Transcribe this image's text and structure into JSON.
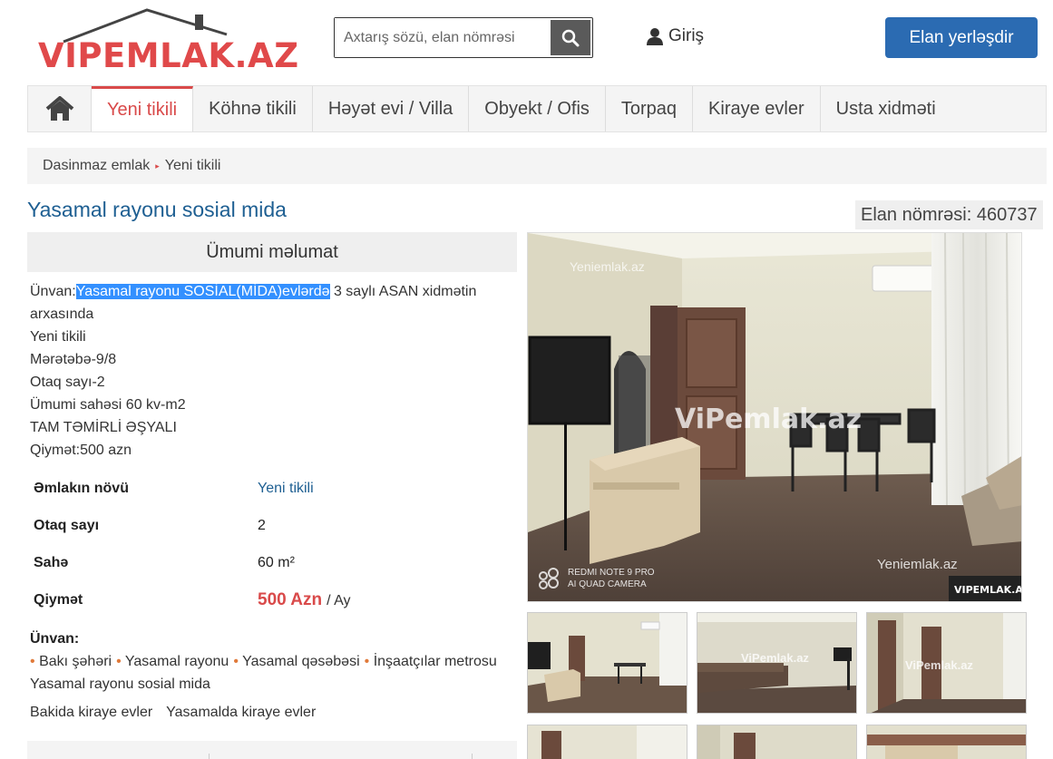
{
  "header": {
    "logo_text": "VIPEMLAK.AZ",
    "search_placeholder": "Axtarış sözü, elan nömrəsi",
    "login_label": "Giriş",
    "post_ad_label": "Elan yerləşdir"
  },
  "nav": {
    "items": [
      "Yeni tikili",
      "Köhnə tikili",
      "Həyət evi / Villa",
      "Obyekt / Ofis",
      "Torpaq",
      "Kiraye evler",
      "Usta xidməti"
    ],
    "active": "Yeni tikili"
  },
  "breadcrumb": [
    "Dasinmaz emlak",
    "Yeni tikili"
  ],
  "listing": {
    "title": "Yasamal rayonu sosial mida",
    "elan_number": "Elan nömrəsi: 460737",
    "section_title": "Ümumi məlumat",
    "desc": {
      "address_prefix": "Ünvan:",
      "address_highlight": "Yasamal rayonu SOSİAL(MİDA)evlərdə",
      "address_rest": " 3 saylı ASAN xidmətin arxasında",
      "lines": [
        "Yeni tikili",
        "Mərətəbə-9/8",
        "Otaq sayı-2",
        "Ümumi sahəsi 60 kv-m2",
        "TAM TƏMİRLİ ƏŞYALI",
        "Qiymət:500 azn"
      ]
    },
    "props": {
      "type_label": "Əmlakın növü",
      "type_value": "Yeni tikili",
      "rooms_label": "Otaq sayı",
      "rooms_value": "2",
      "area_label": "Sahə",
      "area_value": "60 m²",
      "price_label": "Qiymət",
      "price_value": "500 Azn",
      "price_unit": "/ Ay"
    },
    "address": {
      "title": "Ünvan:",
      "parts": [
        "Bakı şəhəri",
        "Yasamal rayonu",
        "Yasamal qəsəbəsi",
        "İnşaatçılar metrosu"
      ],
      "name": "Yasamal rayonu sosial mida"
    },
    "related": [
      "Bakida kiraye evler",
      "Yasamalda kiraye evler"
    ]
  },
  "photos": {
    "watermark_main": "ViPemlak.az",
    "watermark_small": "Yeniemlak.az",
    "corner_badge": "VIPEMLAK.AZ",
    "camera_line1": "REDMI NOTE 9 PRO",
    "camera_line2": "AI QUAD CAMERA",
    "thumb_watermark": "ViPemlak.az"
  },
  "colors": {
    "accent": "#d94a4a",
    "brand_blue": "#2b6bb2",
    "title_blue": "#1e5f92"
  }
}
